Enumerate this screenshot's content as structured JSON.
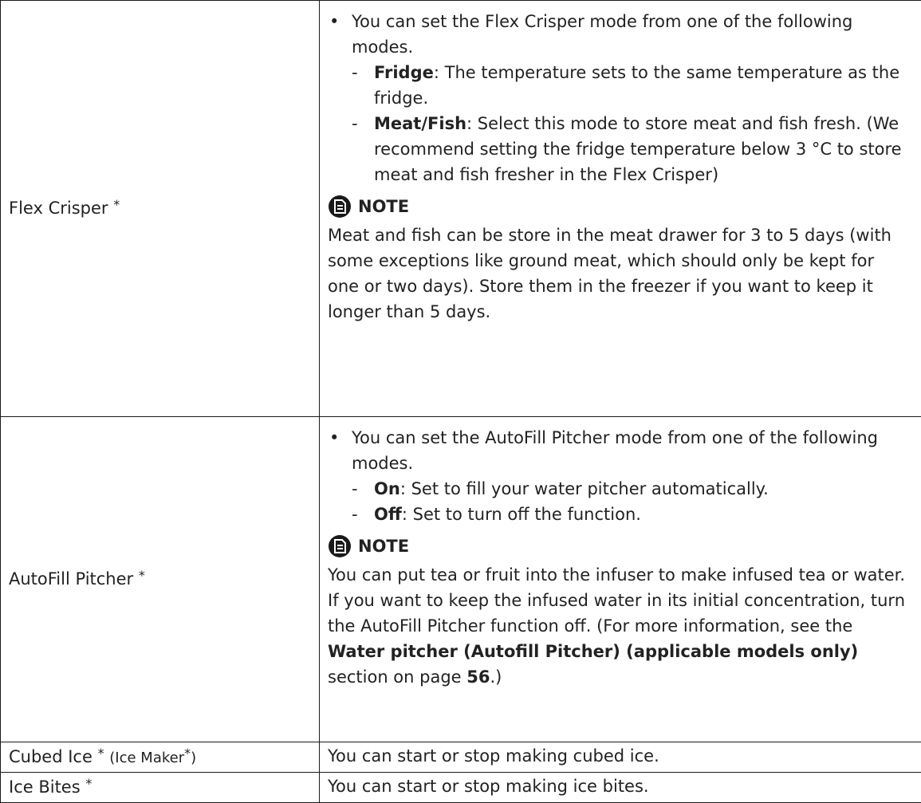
{
  "rows": [
    {
      "feature": "Flex Crisper",
      "intro": "You can set the Flex Crisper mode from one of the following modes.",
      "modes": [
        {
          "name": "Fridge",
          "text": ": The temperature sets to the same temperature as the fridge."
        },
        {
          "name": "Meat/Fish",
          "text": ": Select this mode to store meat and fish fresh. (We recommend setting the fridge temperature below 3 °C to store meat and fish fresher in the Flex Crisper)"
        }
      ],
      "note_title": "NOTE",
      "note_text": "Meat and fish can be store in the meat drawer for 3 to 5 days (with some exceptions like ground meat, which should only be kept for one or two days). Store them in the freezer if you want to keep it longer than 5 days."
    },
    {
      "feature": "AutoFill Pitcher",
      "intro": "You can set the AutoFill Pitcher mode from one of the following modes.",
      "modes": [
        {
          "name": "On",
          "text": ": Set to fill your water pitcher automatically."
        },
        {
          "name": "Off",
          "text": ": Set to turn off the function."
        }
      ],
      "note_title": "NOTE",
      "note_text_before": "You can put tea or fruit into the infuser to make infused tea or water. If you want to keep the infused water in its initial concentration, turn the AutoFill Pitcher function off. (For more information, see the ",
      "note_ref": "Water pitcher (Autofill Pitcher) (applicable models only)",
      "note_text_mid": " section on page ",
      "note_page": "56",
      "note_text_after": ".)"
    },
    {
      "feature": "Cubed Ice",
      "suffix": "(Ice Maker",
      "suffix_close": ")",
      "text": "You can start or stop making cubed ice."
    },
    {
      "feature": "Ice Bites",
      "text": "You can start or stop making ice bites."
    }
  ],
  "star": "*",
  "bullet_char": "•",
  "dash_char": "-",
  "icon_name": "document-note-icon"
}
